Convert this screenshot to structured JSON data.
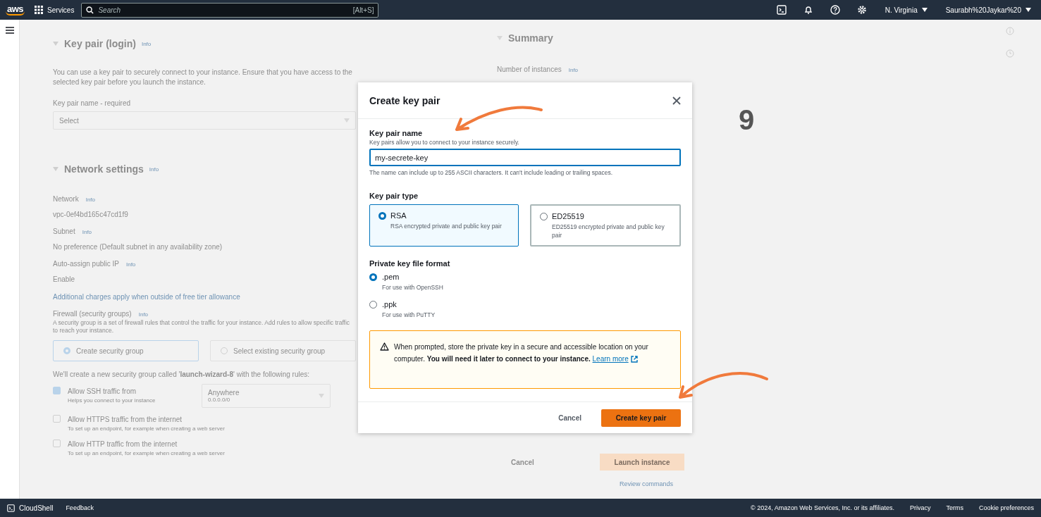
{
  "top_nav": {
    "logo": "aws",
    "services": "Services",
    "search": {
      "placeholder": "Search",
      "shortcut": "[Alt+S]"
    },
    "region": "N. Virginia",
    "account": "Saurabh%20Jaykar%20"
  },
  "background_form": {
    "key_pair_section": {
      "title": "Key pair (login)",
      "info": "Info",
      "description": "You can use a key pair to securely connect to your instance. Ensure that you have access to the selected key pair before you launch the instance.",
      "field_label": "Key pair name - required",
      "select_placeholder": "Select"
    },
    "network_section": {
      "title": "Network settings",
      "info": "Info",
      "fields": [
        {
          "label": "Network",
          "info": "Info",
          "value": "vpc-0ef4bd165c47cd1f9"
        },
        {
          "label": "Subnet",
          "info": "Info",
          "value": "No preference (Default subnet in any availability zone)"
        },
        {
          "label": "Auto-assign public IP",
          "info": "Info",
          "value": "Enable"
        }
      ],
      "charges_note": "Additional charges apply when outside of free tier allowance",
      "firewall": {
        "label": "Firewall (security groups)",
        "info": "Info",
        "description": "A security group is a set of firewall rules that control the traffic for your instance. Add rules to allow specific traffic to reach your instance.",
        "options": [
          {
            "label": "Create security group",
            "selected": true
          },
          {
            "label": "Select existing security group",
            "selected": false
          }
        ],
        "note": "We'll create a new security group called '**launch-wizard-8**' with the following rules:",
        "rules": [
          {
            "label": "Allow SSH traffic from",
            "hint": "Helps you connect to your instance",
            "checked": true,
            "source": "Anywhere",
            "source_detail": "0.0.0.0/0"
          },
          {
            "label": "Allow HTTPS traffic from the internet",
            "hint": "To set up an endpoint, for example when creating a web server",
            "checked": false
          },
          {
            "label": "Allow HTTP traffic from the internet",
            "hint": "To set up an endpoint, for example when creating a web server",
            "checked": false
          }
        ]
      }
    }
  },
  "summary": {
    "title": "Summary",
    "instances_label": "Number of instances",
    "info": "Info",
    "cancel": "Cancel",
    "launch": "Launch instance",
    "review": "Review commands"
  },
  "dialog": {
    "title": "Create key pair",
    "name_label": "Key pair name",
    "name_description": "Key pairs allow you to connect to your instance securely.",
    "name_value": "my-secrete-key",
    "name_hint": "The name can include up to 255 ASCII characters. It can't include leading or trailing spaces.",
    "type_label": "Key pair type",
    "types": [
      {
        "label": "RSA",
        "description": "RSA encrypted private and public key pair",
        "selected": true
      },
      {
        "label": "ED25519",
        "description": "ED25519 encrypted private and public key pair",
        "selected": false
      }
    ],
    "format_label": "Private key file format",
    "formats": [
      {
        "label": ".pem",
        "description": "For use with OpenSSH",
        "selected": true
      },
      {
        "label": ".ppk",
        "description": "For use with PuTTY",
        "selected": false
      }
    ],
    "warning": "When prompted, store the private key in a secure and accessible location on your computer. **You will need it later to connect to your instance.**",
    "learn_more": "Learn more",
    "cancel": "Cancel",
    "create": "Create key pair"
  },
  "annotation": {
    "step": "9"
  },
  "footer": {
    "cloudshell": "CloudShell",
    "feedback": "Feedback",
    "copyright": "© 2024, Amazon Web Services, Inc. or its affiliates.",
    "links": [
      "Privacy",
      "Terms",
      "Cookie preferences"
    ]
  }
}
